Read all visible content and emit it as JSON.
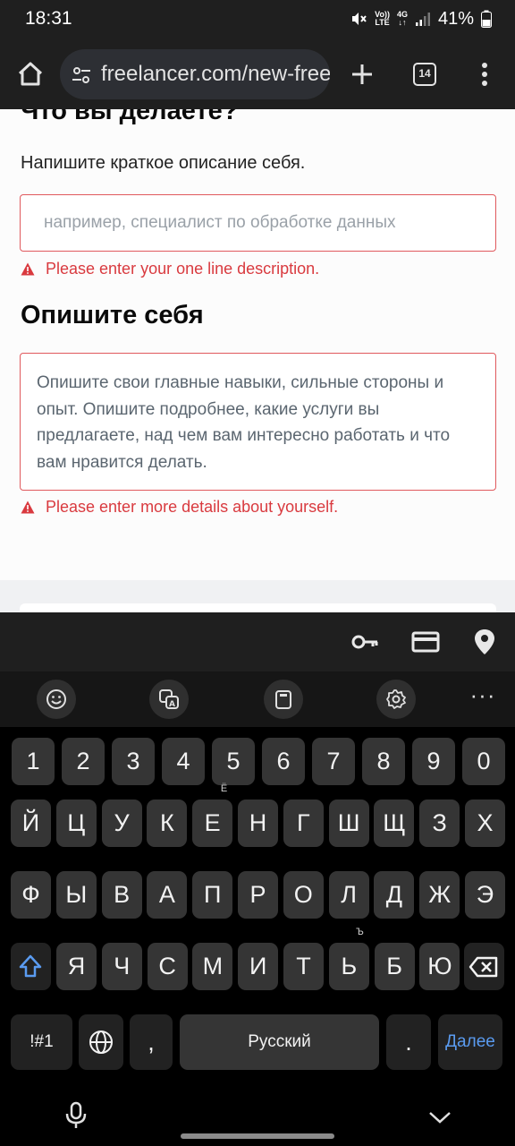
{
  "status_bar": {
    "time": "18:31",
    "network_top": "Vo))",
    "network_bottom": "LTE",
    "data_type": "4G",
    "battery": "41%"
  },
  "browser": {
    "url": "freelancer.com/new-free",
    "tab_count": "14",
    "icons": [
      "home-icon",
      "tune-icon",
      "plus-icon",
      "tab-switcher-icon",
      "more-vert-icon"
    ]
  },
  "page": {
    "heading_what": "Что вы делаете?",
    "short_desc_label": "Напишите краткое описание себя.",
    "short_desc_placeholder": "например, специалист по обработке данных",
    "short_desc_value": "",
    "error_one_line": "Please enter your one line description.",
    "heading_describe": "Опишите себя",
    "about_placeholder": "Опишите свои главные навыки, сильные стороны и опыт. Опишите подробнее, какие услуги вы предлагаете, над чем вам интересно работать и что вам нравится делать.",
    "error_details": "Please enter more details about yourself.",
    "error_color": "#d93a3f"
  },
  "autofill": {
    "icons": [
      "key-icon",
      "credit-card-icon",
      "location-icon"
    ]
  },
  "keyboard": {
    "toolbar_icons": [
      "emoji-icon",
      "translate-icon",
      "clipboard-icon",
      "settings-icon",
      "more-icon"
    ],
    "row_numbers": [
      "1",
      "2",
      "3",
      "4",
      "5",
      "6",
      "7",
      "8",
      "9",
      "0"
    ],
    "row1": [
      "Й",
      "Ц",
      "У",
      "К",
      "Е",
      "Н",
      "Г",
      "Ш",
      "Щ",
      "З",
      "Х"
    ],
    "row1_hint_e": "Ё",
    "row2": [
      "Ф",
      "Ы",
      "В",
      "А",
      "П",
      "Р",
      "О",
      "Л",
      "Д",
      "Ж",
      "Э"
    ],
    "row3": [
      "Я",
      "Ч",
      "С",
      "М",
      "И",
      "Т",
      "Ь",
      "Б",
      "Ю"
    ],
    "row3_hint_soft": "Ъ",
    "symbols_label": "!#1",
    "comma_label": ",",
    "space_label": "Русский",
    "period_label": ".",
    "enter_label": "Далее",
    "accent_color": "#5a9bf0"
  },
  "nav": {
    "icons": [
      "mic-icon",
      "chevron-down-icon"
    ]
  }
}
